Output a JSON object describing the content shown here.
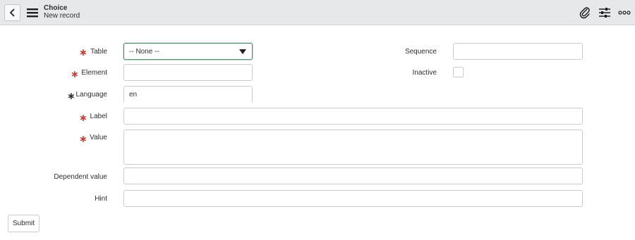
{
  "header": {
    "title": "Choice",
    "subtitle": "New record",
    "icons": [
      "back-icon",
      "hamburger-menu-icon",
      "paperclip-icon",
      "settings-sliders-icon",
      "more-options-icon"
    ]
  },
  "form": {
    "table": {
      "label": "Table",
      "value": "-- None --",
      "required": true
    },
    "element": {
      "label": "Element",
      "value": "",
      "required": true
    },
    "language": {
      "label": "Language",
      "value": "en",
      "required": true
    },
    "label_field": {
      "label": "Label",
      "value": "",
      "required": true
    },
    "value": {
      "label": "Value",
      "value": "",
      "required": true
    },
    "dependent_value": {
      "label": "Dependent value",
      "value": ""
    },
    "hint": {
      "label": "Hint",
      "value": ""
    },
    "sequence": {
      "label": "Sequence",
      "value": ""
    },
    "inactive": {
      "label": "Inactive",
      "checked": false
    },
    "required_marker": "∗"
  },
  "actions": {
    "submit_label": "Submit"
  },
  "colors": {
    "required_red": "#c8382f",
    "header_bg": "#e6e8ea",
    "focus_border": "#4f8a6a"
  }
}
